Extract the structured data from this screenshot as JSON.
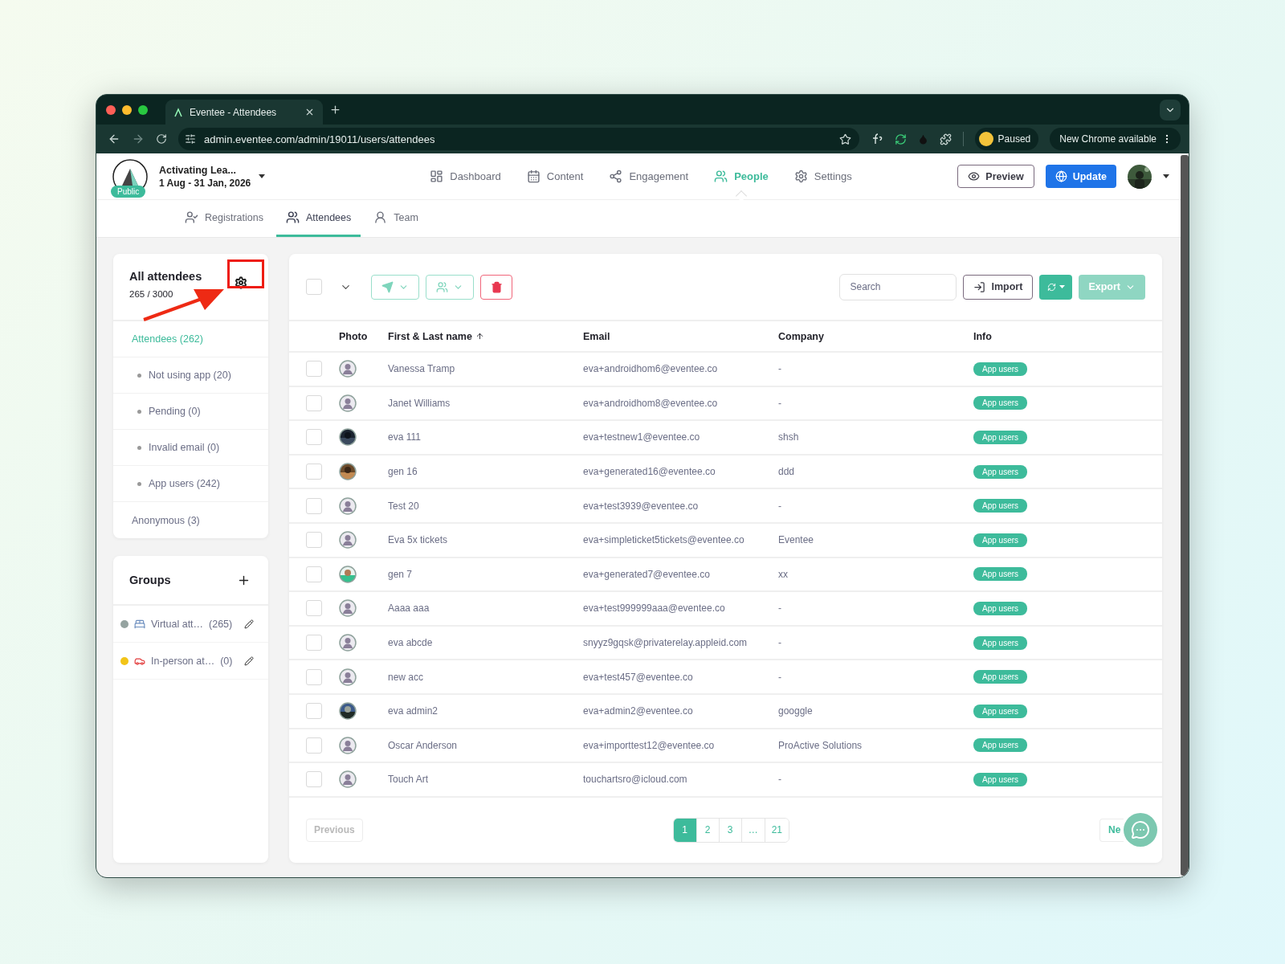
{
  "browser": {
    "tab_title": "Eventee - Attendees",
    "url": "admin.eventee.com/admin/19011/users/attendees",
    "profile_status": "Paused",
    "update_notice": "New Chrome available"
  },
  "event": {
    "name": "Activating Lea...",
    "dates": "1 Aug - 31 Jan, 2026",
    "visibility": "Public"
  },
  "nav": [
    {
      "label": "Dashboard",
      "selected": false
    },
    {
      "label": "Content",
      "selected": false
    },
    {
      "label": "Engagement",
      "selected": false
    },
    {
      "label": "People",
      "selected": true
    },
    {
      "label": "Settings",
      "selected": false
    }
  ],
  "actions": {
    "preview": "Preview",
    "update": "Update"
  },
  "subnav": [
    {
      "label": "Registrations",
      "selected": false
    },
    {
      "label": "Attendees",
      "selected": true
    },
    {
      "label": "Team",
      "selected": false
    }
  ],
  "filters": {
    "title": "All attendees",
    "count": "265 / 3000",
    "items": [
      {
        "label": "Attendees (262)",
        "kind": "main",
        "selected": true
      },
      {
        "label": "Not using app (20)",
        "kind": "sub",
        "selected": false
      },
      {
        "label": "Pending (0)",
        "kind": "sub",
        "selected": false
      },
      {
        "label": "Invalid email (0)",
        "kind": "sub",
        "selected": false
      },
      {
        "label": "App users (242)",
        "kind": "sub",
        "selected": false
      },
      {
        "label": "Anonymous (3)",
        "kind": "main",
        "selected": false
      }
    ]
  },
  "groups": {
    "title": "Groups",
    "items": [
      {
        "label": "Virtual att…",
        "count": "(265)",
        "color": "#95a3a0"
      },
      {
        "label": "In-person at…",
        "count": "(0)",
        "color": "#f2c418"
      }
    ]
  },
  "toolbar": {
    "select_all": {
      "checked": false
    },
    "search": {
      "placeholder": "Search"
    },
    "import": "Import",
    "export": {
      "label": "Export",
      "disabled": true
    }
  },
  "table": {
    "columns": [
      {
        "label": "Photo"
      },
      {
        "label": "First & Last name"
      },
      {
        "label": "Email"
      },
      {
        "label": "Company"
      },
      {
        "label": "Info"
      }
    ],
    "rows": [
      {
        "kind": "placeholder",
        "name": "Vanessa Tramp",
        "email": "eva+androidhom6@eventee.co",
        "company": "-",
        "info": "App users",
        "checked": false
      },
      {
        "kind": "placeholder",
        "name": "Janet Williams",
        "email": "eva+androidhom8@eventee.co",
        "company": "-",
        "info": "App users",
        "checked": false
      },
      {
        "kind": "picture",
        "name": "eva 111",
        "email": "eva+testnew1@eventee.co",
        "company": "shsh",
        "info": "App users",
        "checked": false
      },
      {
        "kind": "picture",
        "name": "gen 16",
        "email": "eva+generated16@eventee.co",
        "company": "ddd",
        "info": "App users",
        "checked": false
      },
      {
        "kind": "placeholder",
        "name": "Test 20",
        "email": "eva+test3939@eventee.co",
        "company": "-",
        "info": "App users",
        "checked": false
      },
      {
        "kind": "placeholder",
        "name": "Eva 5x tickets",
        "email": "eva+simpleticket5tickets@eventee.co",
        "company": "Eventee",
        "info": "App users",
        "checked": false
      },
      {
        "kind": "picture",
        "name": "gen 7",
        "email": "eva+generated7@eventee.co",
        "company": "xx",
        "info": "App users",
        "checked": false
      },
      {
        "kind": "placeholder",
        "name": "Aaaa aaa",
        "email": "eva+test999999aaa@eventee.co",
        "company": "-",
        "info": "App users",
        "checked": false
      },
      {
        "kind": "placeholder",
        "name": "eva abcde",
        "email": "snyyz9gqsk@privaterelay.appleid.com",
        "company": "-",
        "info": "App users",
        "checked": false
      },
      {
        "kind": "placeholder",
        "name": "new acc",
        "email": "eva+test457@eventee.co",
        "company": "-",
        "info": "App users",
        "checked": false
      },
      {
        "kind": "picture",
        "name": "eva admin2",
        "email": "eva+admin2@eventee.co",
        "company": "googgle",
        "info": "App users",
        "checked": false
      },
      {
        "kind": "placeholder",
        "name": "Oscar Anderson",
        "email": "eva+importtest12@eventee.co",
        "company": "ProActive Solutions",
        "info": "App users",
        "checked": false
      },
      {
        "kind": "placeholder",
        "name": "Touch Art",
        "email": "touchartsro@icloud.com",
        "company": "-",
        "info": "App users",
        "checked": false
      }
    ]
  },
  "pagination": {
    "previous": {
      "label": "Previous",
      "disabled": true
    },
    "pages": [
      {
        "label": "1",
        "selected": true
      },
      {
        "label": "2",
        "selected": false
      },
      {
        "label": "3",
        "selected": false
      },
      {
        "label": "…",
        "selected": false
      },
      {
        "label": "21",
        "selected": false
      }
    ],
    "next": "Ne"
  }
}
